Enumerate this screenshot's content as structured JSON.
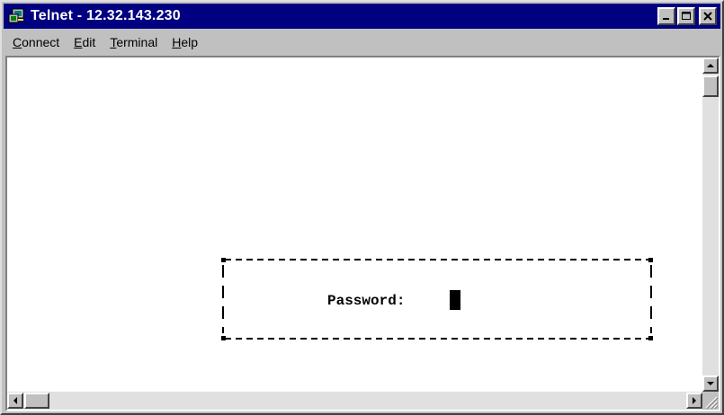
{
  "window": {
    "title": "Telnet - 12.32.143.230",
    "icon": "telnet-app-icon"
  },
  "title_buttons": {
    "minimize_icon": "minimize-icon",
    "maximize_icon": "maximize-icon",
    "close_icon": "close-icon"
  },
  "menu": {
    "items": [
      {
        "accel": "C",
        "rest": "onnect"
      },
      {
        "accel": "E",
        "rest": "dit"
      },
      {
        "accel": "T",
        "rest": "erminal"
      },
      {
        "accel": "H",
        "rest": "elp"
      }
    ]
  },
  "terminal": {
    "prompt": "Password:",
    "input_value": ""
  },
  "colors": {
    "titlebar": "#000080",
    "window_face": "#c0c0c0",
    "terminal_bg": "#ffffff",
    "terminal_text": "#000000"
  }
}
